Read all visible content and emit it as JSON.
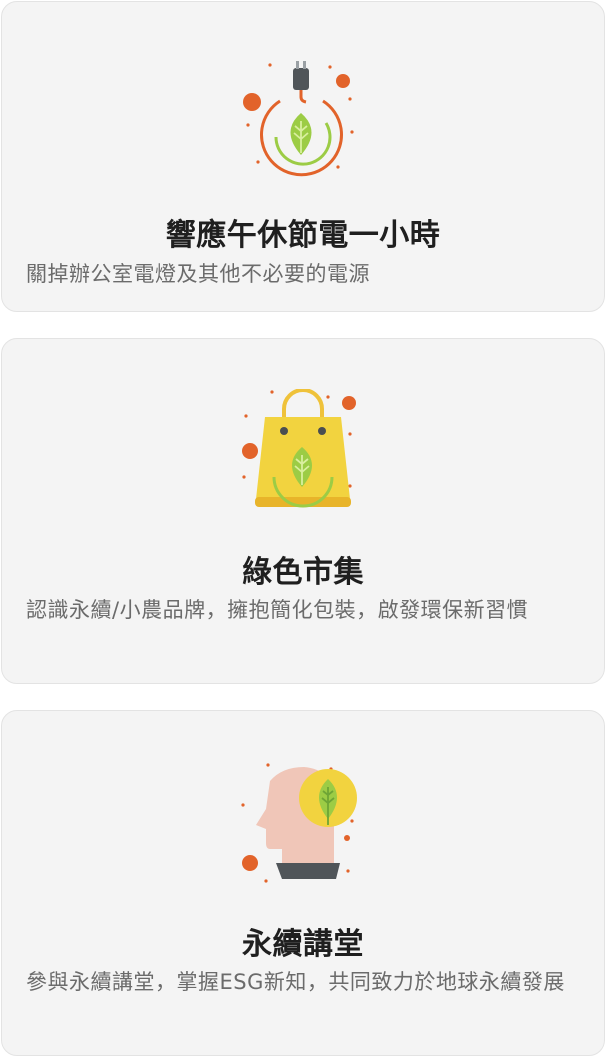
{
  "cards": [
    {
      "icon": "power-plug-leaf-icon",
      "title": "響應午休節電一小時",
      "description": "關掉辦公室電燈及其他不必要的電源"
    },
    {
      "icon": "shopping-bag-leaf-icon",
      "title": "綠色市集",
      "description": "認識永續/小農品牌，擁抱簡化包裝，啟發環保新習慣"
    },
    {
      "icon": "head-leaf-idea-icon",
      "title": "永續講堂",
      "description": "參與永續講堂，掌握ESG新知，共同致力於地球永續發展"
    }
  ],
  "colors": {
    "card_bg": "#f4f4f4",
    "title": "#1f1f1f",
    "description": "#6b6b6b",
    "accent_orange": "#e2632a",
    "leaf_green": "#9ccc45",
    "bag_yellow": "#f2d33f",
    "head_skin": "#f0c6b8"
  }
}
